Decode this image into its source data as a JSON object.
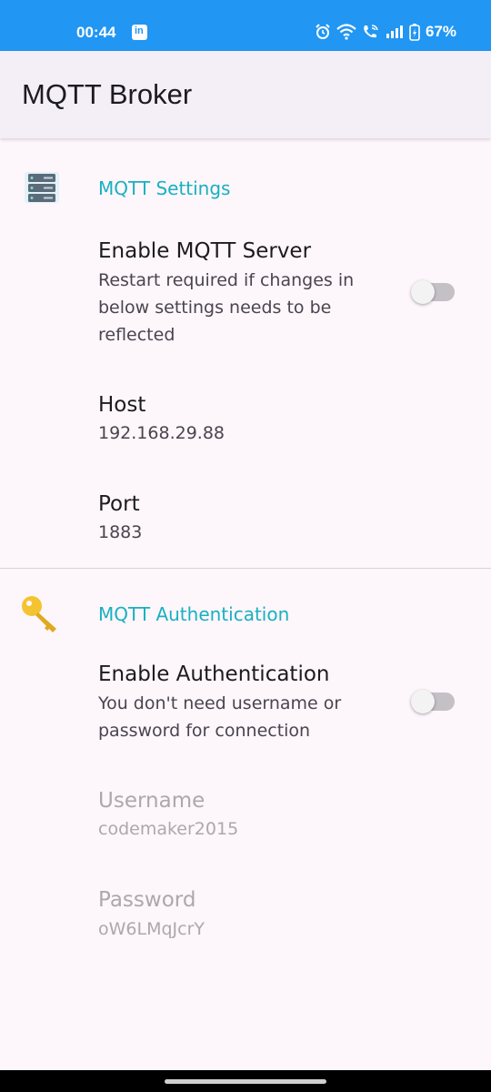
{
  "status_bar": {
    "time": "00:44",
    "battery": "67%",
    "linkedin_icon_text": "in"
  },
  "app_bar": {
    "title": "MQTT Broker"
  },
  "mqtt_settings": {
    "header": "MQTT Settings",
    "enable_server": {
      "title": "Enable MQTT Server",
      "summary": "Restart required if changes in below settings needs to be reflected",
      "enabled": false
    },
    "host": {
      "title": "Host",
      "value": "192.168.29.88"
    },
    "port": {
      "title": "Port",
      "value": "1883"
    }
  },
  "mqtt_authentication": {
    "header": "MQTT Authentication",
    "enable_auth": {
      "title": "Enable Authentication",
      "summary": "You don't need username or password for connection",
      "enabled": false
    },
    "username": {
      "title": "Username",
      "value": "codemaker2015"
    },
    "password": {
      "title": "Password",
      "value": "oW6LMqJcrY"
    }
  },
  "colors": {
    "status_bar": "#2196f3",
    "accent": "#17b1c0",
    "background": "#fdf6fb"
  }
}
